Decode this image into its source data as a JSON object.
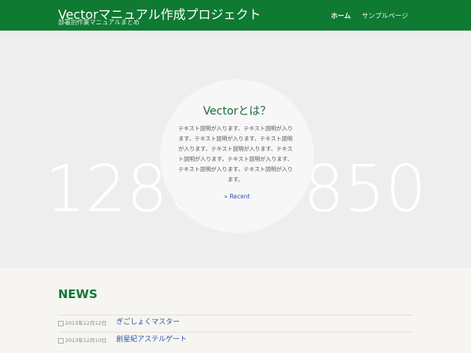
{
  "header": {
    "site_title": "Vectorマニュアル作成プロジェクト",
    "site_description": "部署別作業マニュアルまとめ",
    "nav": [
      {
        "label": "ホーム",
        "active": true
      },
      {
        "label": "サンプルページ",
        "active": false
      }
    ]
  },
  "hero": {
    "placeholder_text": "1280 × 850",
    "title": "Vectorとは？",
    "text": "テキスト説明が入ります、テキスト説明が入ります、テキスト説明が入ります、テキスト説明が入ります、テキスト説明が入ります、テキスト説明が入ります、テキスト説明が入ります、テキスト説明が入ります、テキスト説明が入ります。",
    "link": "» Recent"
  },
  "news": {
    "title": "NEWS",
    "items": [
      {
        "date": "2013年12月12日",
        "title": "ぎごしょくマスター"
      },
      {
        "date": "2013年12月10日",
        "title": "創星紀アステルゲート"
      }
    ]
  },
  "colors": {
    "header_bg": "#0e7a32",
    "accent_green": "#1b6b3a",
    "link_blue": "#2b55a6"
  }
}
